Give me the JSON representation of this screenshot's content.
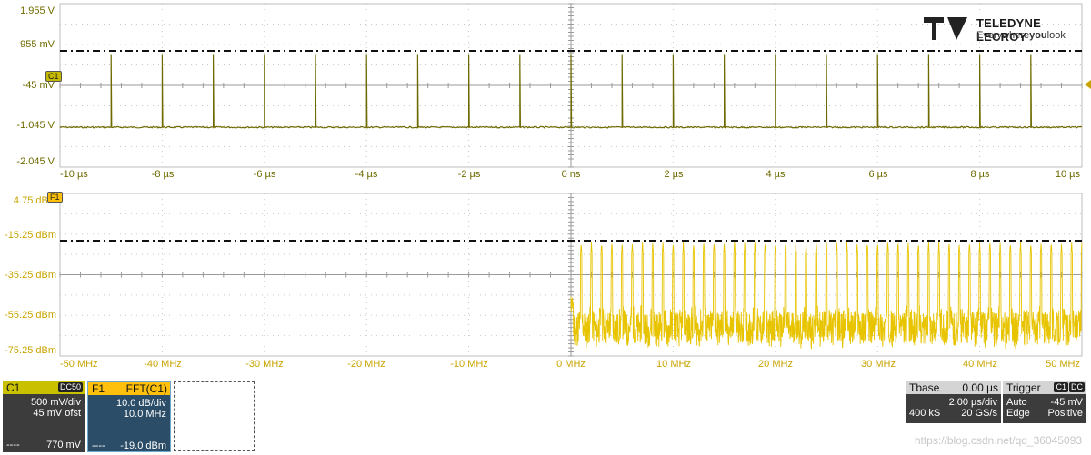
{
  "brand": {
    "name": "TELEDYNE LECROY",
    "tagline_a": "Everywhere",
    "tagline_b": "you",
    "tagline_c": "look"
  },
  "colors": {
    "channel": "#6e6a00",
    "fft": "#e8c400",
    "fft_panel": "#fec00d"
  },
  "time_grid": {
    "y_labels": [
      "1.955 V",
      "955 mV",
      "-45 mV",
      "-1.045 V",
      "-2.045 V"
    ],
    "x_labels": [
      "-10 µs",
      "-8 µs",
      "-6 µs",
      "-4 µs",
      "-2 µs",
      "0 ns",
      "2 µs",
      "4 µs",
      "6 µs",
      "8 µs",
      "10 µs"
    ],
    "channel_marker": "C1"
  },
  "fft_grid": {
    "y_labels": [
      "4.75 dBm",
      "-15.25 dBm",
      "-35.25 dBm",
      "-55.25 dBm",
      "-75.25 dBm"
    ],
    "x_labels": [
      "-50 MHz",
      "-40 MHz",
      "-30 MHz",
      "-20 MHz",
      "-10 MHz",
      "0 MHz",
      "10 MHz",
      "20 MHz",
      "30 MHz",
      "40 MHz",
      "50 MHz"
    ],
    "math_marker": "F1"
  },
  "chart_data": [
    {
      "type": "line",
      "series": [
        {
          "name": "C1",
          "description_points": {
            "baseline": -1.07,
            "pulse_peak": 0.7,
            "pulse_times_us": [
              -9.0,
              -8.0,
              -7.0,
              -6.0,
              -5.0,
              -4.0,
              -3.0,
              -2.0,
              -1.0,
              0.0,
              1.0,
              2.0,
              3.0,
              4.0,
              5.0,
              6.0,
              7.0,
              8.0,
              9.0
            ]
          }
        }
      ],
      "xlabel": "",
      "ylabel": "",
      "xlim_us": [
        -10,
        10
      ],
      "ylim_V": [
        -2.045,
        1.955
      ],
      "trigger_level_V": 0.955,
      "grid": true
    },
    {
      "type": "line",
      "series": [
        {
          "name": "F1",
          "description_points": {
            "start_MHz": 0,
            "stop_MHz": 50,
            "peak_spacing_MHz": 1.0,
            "peak_dBm": -19.0,
            "floor_dBm": -75.0
          }
        }
      ],
      "xlabel": "",
      "ylabel": "",
      "xlim_MHz": [
        -50,
        50
      ],
      "ylim_dBm": [
        -75.25,
        4.75
      ],
      "marker_level_dBm": -19.0,
      "grid": true
    }
  ],
  "panels": {
    "c1": {
      "label": "C1",
      "coupling": "DC50",
      "scale": "500 mV/div",
      "offset": "45 mV ofst",
      "reading_prefix": "----",
      "reading": "770 mV"
    },
    "f1": {
      "label": "F1",
      "function": "FFT(C1)",
      "scale": "10.0 dB/div",
      "center": "10.0 MHz",
      "reading_prefix": "----",
      "reading": "-19.0 dBm"
    },
    "tbase": {
      "label": "Tbase",
      "delay": "0.00 µs",
      "time_div": "2.00 µs/div",
      "samples": "400 kS",
      "rate": "20 GS/s"
    },
    "trigger": {
      "label": "Trigger",
      "src": "C1",
      "coupling": "DC",
      "mode": "Auto",
      "level": "-45 mV",
      "type": "Edge",
      "slope": "Positive"
    }
  },
  "watermark": "https://blog.csdn.net/qq_36045093"
}
